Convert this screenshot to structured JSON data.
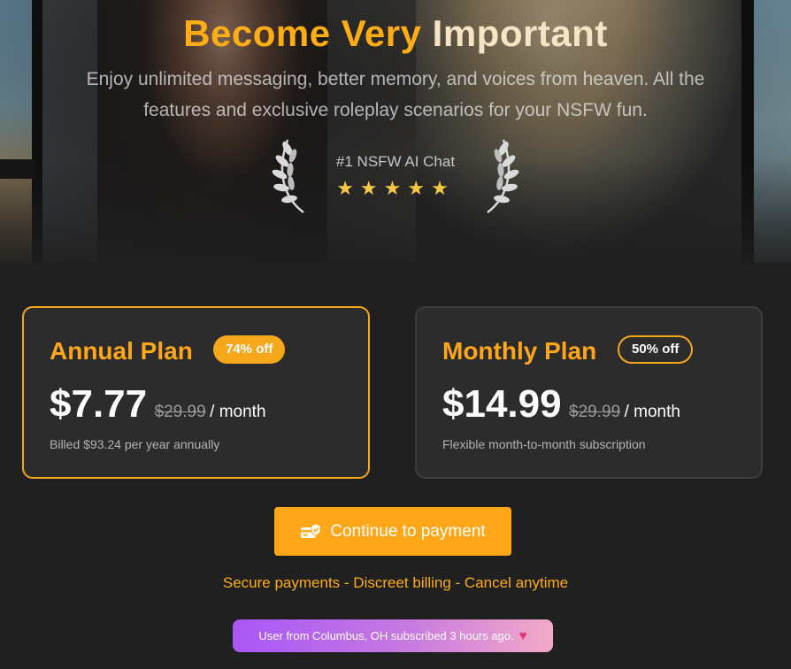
{
  "hero": {
    "title_a": "Become Very",
    "title_b": "Important",
    "subtitle": "Enjoy unlimited messaging, better memory, and voices from heaven. All the features and exclusive roleplay scenarios for your NSFW fun.",
    "award_label": "#1 NSFW AI Chat",
    "stars": "★★★★★",
    "rating": 5
  },
  "plans": [
    {
      "name": "Annual Plan",
      "badge": "74% off",
      "price": "$7.77",
      "old_price": "$29.99",
      "per": "/ month",
      "note": "Billed $93.24 per year annually",
      "selected": true
    },
    {
      "name": "Monthly Plan",
      "badge": "50% off",
      "price": "$14.99",
      "old_price": "$29.99",
      "per": "/ month",
      "note": "Flexible month-to-month subscription",
      "selected": false
    }
  ],
  "cta": {
    "label": "Continue to payment",
    "icon": "secure-card-icon"
  },
  "trust_line": "Secure payments - Discreet billing - Cancel anytime",
  "toast": {
    "text": "User from Columbus, OH subscribed 3 hours ago.",
    "icon": "heart-icon"
  },
  "colors": {
    "accent": "#ffa719",
    "background": "#202020",
    "card": "#2c2c2c"
  }
}
